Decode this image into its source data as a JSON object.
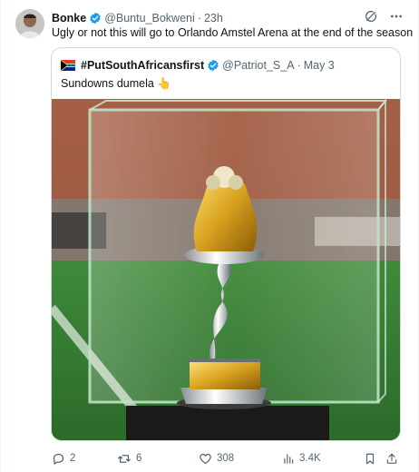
{
  "tweet": {
    "author_name": "Bonke",
    "author_handle": "@Buntu_Bokweni",
    "dot": "·",
    "time": "23h",
    "text": "Ugly or not this will go to Orlando Amstel Arena at the end of the season 🤞🏽"
  },
  "quoted": {
    "author_name": "#PutSouthAfricansfirst",
    "author_handle": "@Patriot_S_A",
    "dot": "·",
    "date": "May 3",
    "text": "Sundowns dumela 👆",
    "image_alt": "Gold and silver trophy in a glass case on a football pitch"
  },
  "actions": {
    "replies": "2",
    "retweets": "6",
    "likes": "308",
    "views": "3.4K"
  },
  "icons": {
    "verified": "verified-badge-icon",
    "grok": "grok-icon",
    "more": "more-icon",
    "reply": "reply-icon",
    "retweet": "retweet-icon",
    "like": "like-icon",
    "views": "views-icon",
    "bookmark": "bookmark-icon",
    "share": "share-icon"
  },
  "colors": {
    "verified": "#1d9bf0",
    "secondary_text": "#536471",
    "border": "#cfd9de"
  }
}
